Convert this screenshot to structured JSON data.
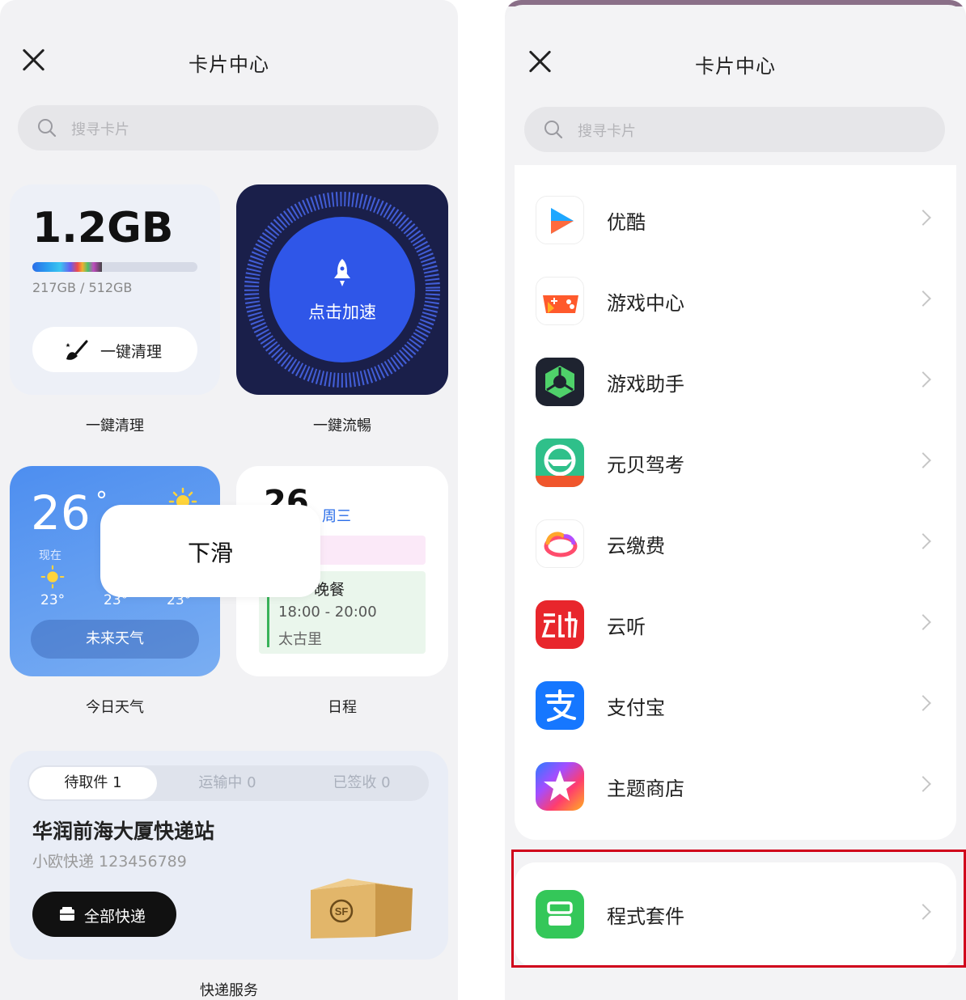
{
  "left_panel": {
    "title": "卡片中心",
    "search_placeholder": "搜寻卡片",
    "cards": {
      "clean": {
        "used_amount": "1.2GB",
        "storage": "217GB / 512GB",
        "storage_fraction": 0.42,
        "button_label": "一键清理",
        "caption": "一鍵清理"
      },
      "speed": {
        "label": "点击加速",
        "caption": "一鍵流暢"
      },
      "weather": {
        "temperature": "26",
        "degree": "°",
        "now_label": "现在",
        "temps": [
          "23°",
          "23°",
          "23°"
        ],
        "future_button": "未来天气",
        "caption": "今日天气"
      },
      "schedule": {
        "date_partial": "26",
        "weekday": "周三",
        "event_partial": "晚餐",
        "time": "18:00 - 20:00",
        "location": "太古里",
        "caption": "日程"
      },
      "express": {
        "tabs": [
          "待取件 1",
          "运输中 0",
          "已签收 0"
        ],
        "station": "华润前海大厦快递站",
        "tracking": "小欧快递 123456789",
        "all_button": "全部快递",
        "caption": "快递服务",
        "box_logo": "SF"
      }
    },
    "tooltip": "下滑"
  },
  "right_panel": {
    "title": "卡片中心",
    "search_placeholder": "搜寻卡片",
    "apps": [
      {
        "name": "优酷",
        "icon": "youku-icon"
      },
      {
        "name": "游戏中心",
        "icon": "game-center-icon"
      },
      {
        "name": "游戏助手",
        "icon": "game-assistant-icon"
      },
      {
        "name": "元贝驾考",
        "icon": "yuanbei-driving-icon"
      },
      {
        "name": "云缴费",
        "icon": "cloud-payment-icon"
      },
      {
        "name": "云听",
        "icon": "yunting-icon"
      },
      {
        "name": "支付宝",
        "icon": "alipay-icon"
      },
      {
        "name": "主题商店",
        "icon": "theme-store-icon"
      }
    ],
    "highlighted_item": {
      "name": "程式套件",
      "icon": "widget-kit-icon"
    },
    "highlight_color": "#d0021b"
  }
}
